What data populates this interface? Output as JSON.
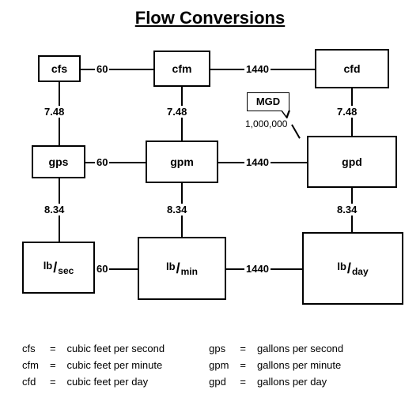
{
  "title": "Flow Conversions",
  "boxes": {
    "cfs": "cfs",
    "cfm": "cfm",
    "cfd": "cfd",
    "gps": "gps",
    "gpm": "gpm",
    "gpd": "gpd",
    "lbsec_top": "lb",
    "lbsec_bot": "sec",
    "lbmin_top": "lb",
    "lbmin_bot": "min",
    "lbday_top": "lb",
    "lbday_bot": "day"
  },
  "factors": {
    "h60_a": "60",
    "h60_b": "60",
    "h60_c": "60",
    "h1440_a": "1440",
    "h1440_b": "1440",
    "h1440_c": "1440",
    "v748_a": "7.48",
    "v748_b": "7.48",
    "v748_c": "7.48",
    "v834_a": "8.34",
    "v834_b": "8.34",
    "v834_c": "8.34"
  },
  "mgd": {
    "label": "MGD",
    "value": "1,000,000"
  },
  "legend": {
    "left": [
      {
        "sym": "cfs",
        "def": "cubic feet per second"
      },
      {
        "sym": "cfm",
        "def": "cubic feet per minute"
      },
      {
        "sym": "cfd",
        "def": "cubic feet per day"
      }
    ],
    "right": [
      {
        "sym": "gps",
        "def": "gallons per second"
      },
      {
        "sym": "gpm",
        "def": "gallons per minute"
      },
      {
        "sym": "gpd",
        "def": "gallons per day"
      }
    ],
    "eq": "="
  }
}
